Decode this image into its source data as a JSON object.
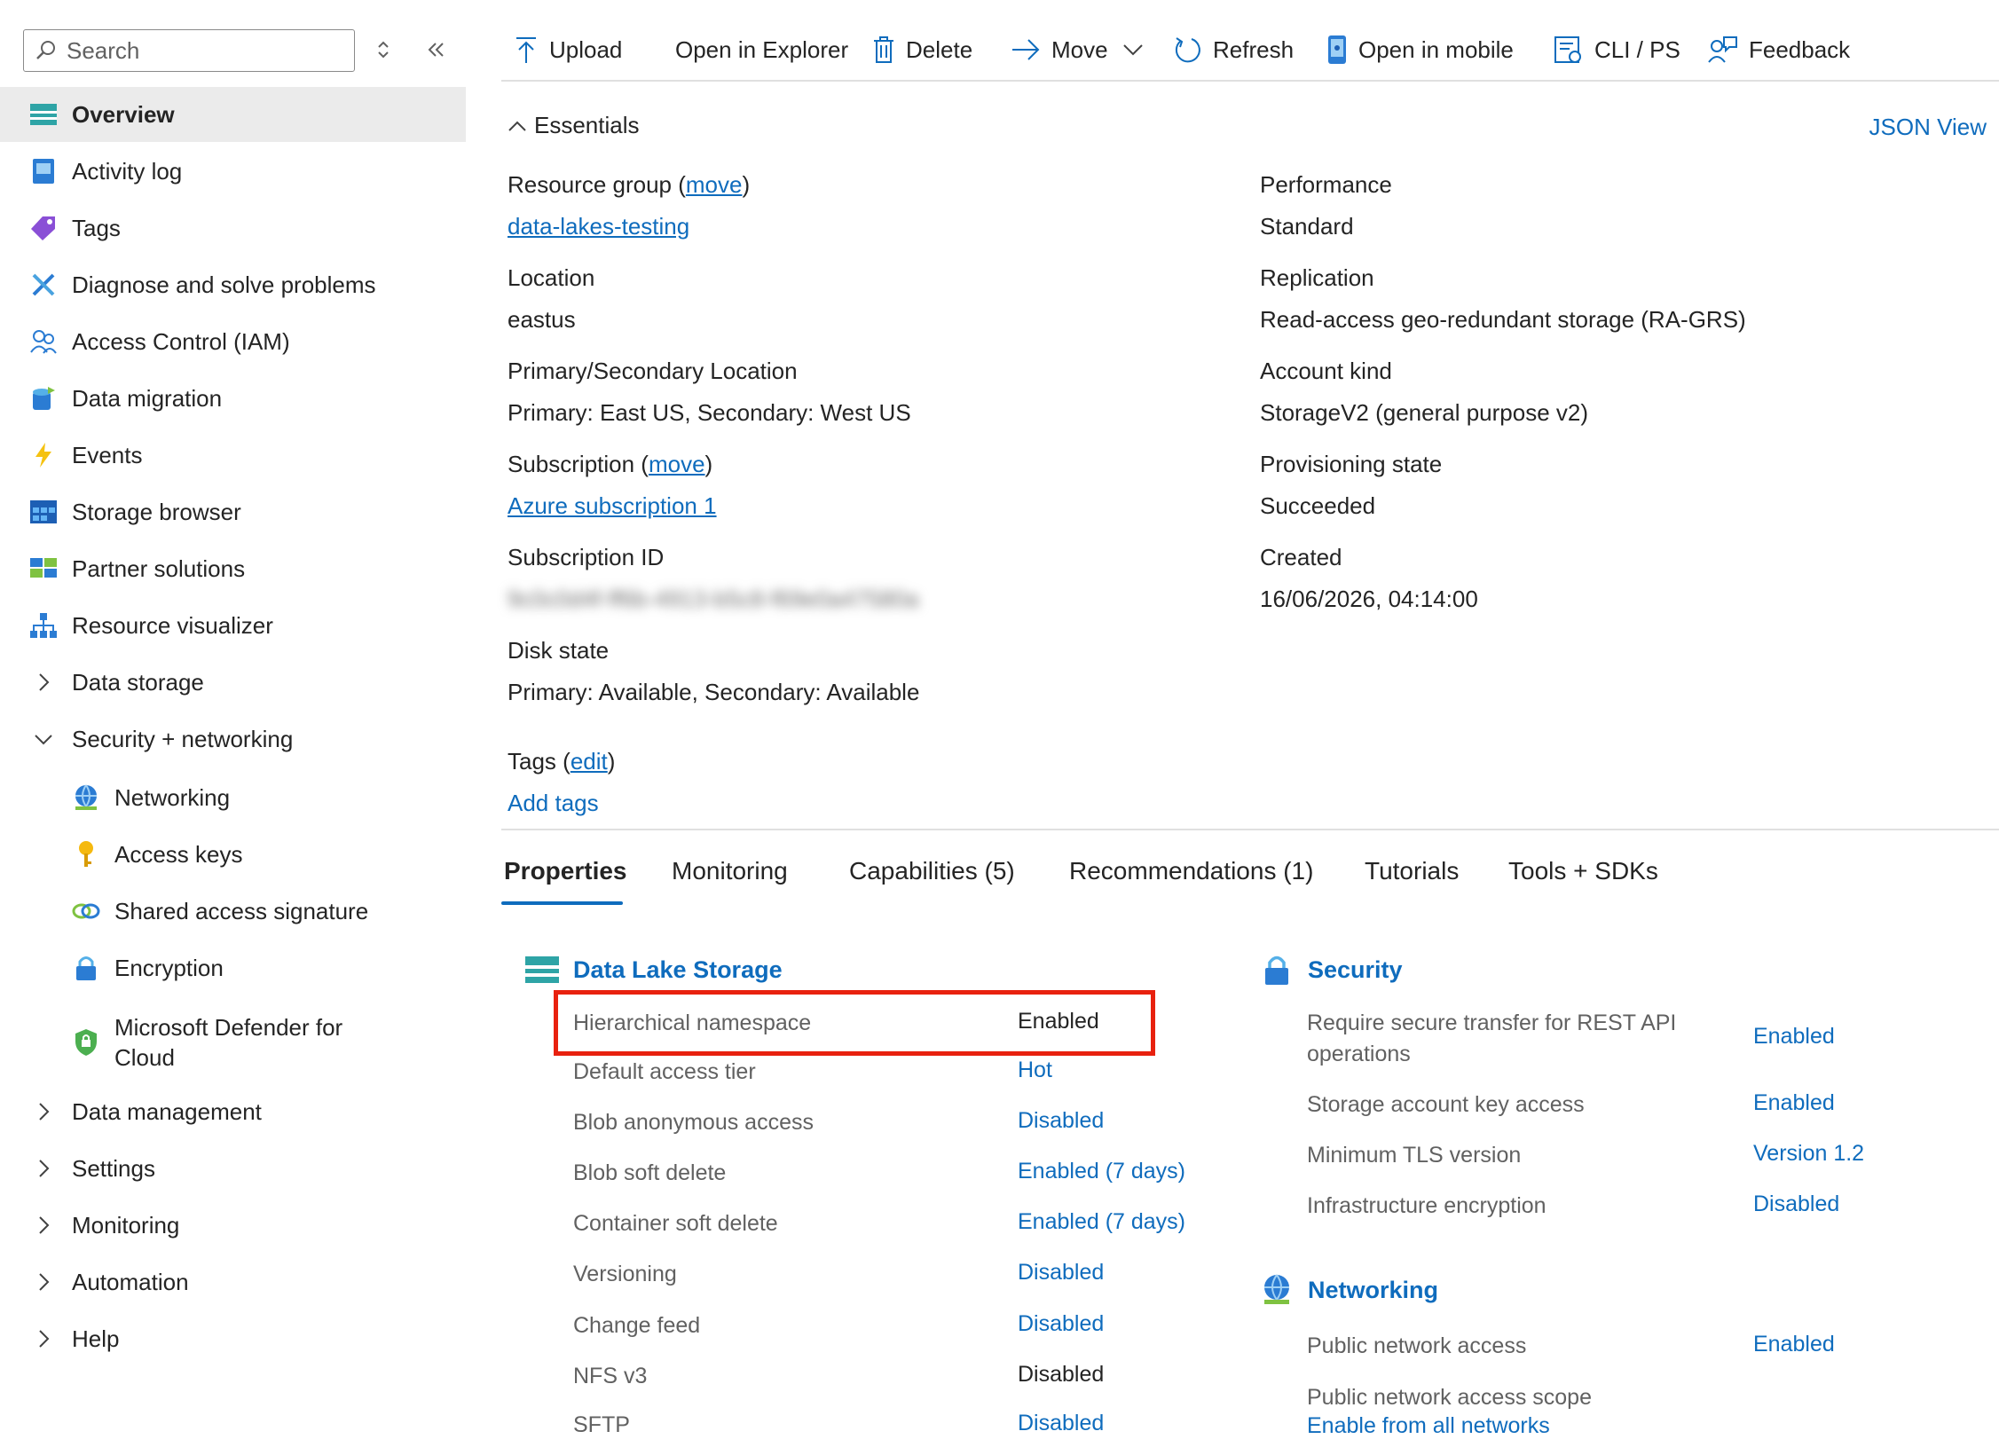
{
  "sidebar": {
    "search_placeholder": "Search",
    "items": [
      {
        "label": "Overview"
      },
      {
        "label": "Activity log"
      },
      {
        "label": "Tags"
      },
      {
        "label": "Diagnose and solve problems"
      },
      {
        "label": "Access Control (IAM)"
      },
      {
        "label": "Data migration"
      },
      {
        "label": "Events"
      },
      {
        "label": "Storage browser"
      },
      {
        "label": "Partner solutions"
      },
      {
        "label": "Resource visualizer"
      },
      {
        "label": "Data storage"
      },
      {
        "label": "Security + networking"
      },
      {
        "label": "Networking"
      },
      {
        "label": "Access keys"
      },
      {
        "label": "Shared access signature"
      },
      {
        "label": "Encryption"
      },
      {
        "label": "Microsoft Defender for Cloud"
      },
      {
        "label": "Data management"
      },
      {
        "label": "Settings"
      },
      {
        "label": "Monitoring"
      },
      {
        "label": "Automation"
      },
      {
        "label": "Help"
      }
    ]
  },
  "toolbar": {
    "upload": "Upload",
    "open_explorer": "Open in Explorer",
    "delete": "Delete",
    "move": "Move",
    "refresh": "Refresh",
    "open_mobile": "Open in mobile",
    "cli_ps": "CLI / PS",
    "feedback": "Feedback"
  },
  "essentials": {
    "title": "Essentials",
    "json_view": "JSON View",
    "resource_group_label": "Resource group",
    "move_link": "move",
    "resource_group_value": "data-lakes-testing",
    "location_label": "Location",
    "location_value": "eastus",
    "primary_secondary_label": "Primary/Secondary Location",
    "primary_secondary_value": "Primary: East US, Secondary: West US",
    "subscription_label": "Subscription",
    "subscription_value": "Azure subscription 1",
    "subscription_id_label": "Subscription ID",
    "subscription_id_value": "9c0c0d4f-ff6b-4913-b5c8-f69e0a47580a",
    "disk_state_label": "Disk state",
    "disk_state_value": "Primary: Available, Secondary: Available",
    "performance_label": "Performance",
    "performance_value": "Standard",
    "replication_label": "Replication",
    "replication_value": "Read-access geo-redundant storage (RA-GRS)",
    "account_kind_label": "Account kind",
    "account_kind_value": "StorageV2 (general purpose v2)",
    "provisioning_label": "Provisioning state",
    "provisioning_value": "Succeeded",
    "created_label": "Created",
    "created_value": "16/06/2026, 04:14:00",
    "tags_label": "Tags",
    "edit_link": "edit",
    "add_tags": "Add tags"
  },
  "tabs": [
    "Properties",
    "Monitoring",
    "Capabilities (5)",
    "Recommendations (1)",
    "Tutorials",
    "Tools + SDKs"
  ],
  "data_lake": {
    "title": "Data Lake Storage",
    "rows": [
      {
        "label": "Hierarchical namespace",
        "value": "Enabled"
      },
      {
        "label": "Default access tier",
        "value": "Hot"
      },
      {
        "label": "Blob anonymous access",
        "value": "Disabled"
      },
      {
        "label": "Blob soft delete",
        "value": "Enabled (7 days)"
      },
      {
        "label": "Container soft delete",
        "value": "Enabled (7 days)"
      },
      {
        "label": "Versioning",
        "value": "Disabled"
      },
      {
        "label": "Change feed",
        "value": "Disabled"
      },
      {
        "label": "NFS v3",
        "value": "Disabled"
      },
      {
        "label": "SFTP",
        "value": "Disabled"
      }
    ]
  },
  "security": {
    "title": "Security",
    "rows": [
      {
        "label1": "Require secure transfer for REST API",
        "label2": "operations",
        "value": "Enabled"
      },
      {
        "label": "Storage account key access",
        "value": "Enabled"
      },
      {
        "label": "Minimum TLS version",
        "value": "Version 1.2"
      },
      {
        "label": "Infrastructure encryption",
        "value": "Disabled"
      }
    ]
  },
  "networking": {
    "title": "Networking",
    "public_access_label": "Public network access",
    "public_access_value": "Enabled",
    "scope_label": "Public network access scope",
    "scope_value": "Enable from all networks"
  },
  "colors": {
    "accent": "#0f6cbd",
    "highlight": "#e8210f",
    "active_bg": "#ebebeb"
  }
}
